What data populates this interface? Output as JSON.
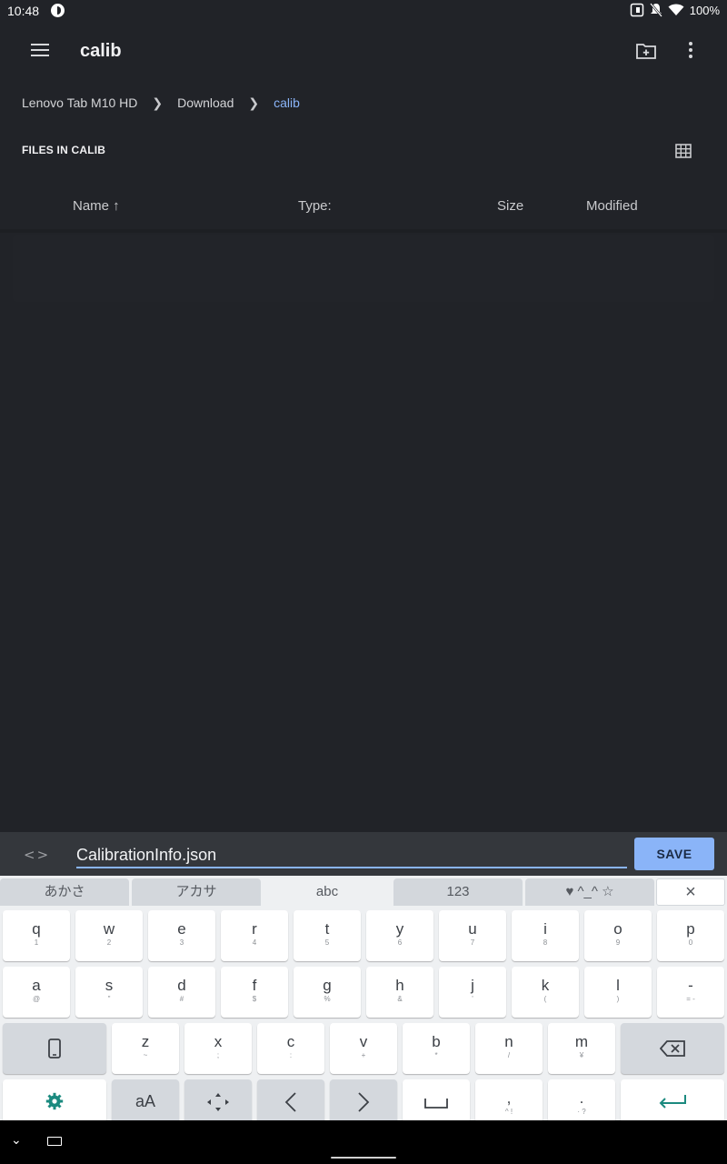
{
  "status_bar": {
    "time": "10:48",
    "battery": "100%"
  },
  "toolbar": {
    "title": "calib"
  },
  "breadcrumb": [
    {
      "label": "Lenovo Tab M10 HD"
    },
    {
      "label": "Download"
    },
    {
      "label": "calib"
    }
  ],
  "section": {
    "title": "FILES IN CALIB"
  },
  "columns": {
    "name": "Name ↑",
    "type": "Type:",
    "size": "Size",
    "modified": "Modified"
  },
  "save_bar": {
    "filename": "CalibrationInfo.json",
    "save_label": "SAVE"
  },
  "keyboard": {
    "tabs": [
      "あかさ",
      "アカサ",
      "abc",
      "123",
      "♥ ^_^ ☆"
    ],
    "active_tab": "abc",
    "close": "×",
    "row1": [
      {
        "k": "q",
        "s": "1"
      },
      {
        "k": "w",
        "s": "2"
      },
      {
        "k": "e",
        "s": "3"
      },
      {
        "k": "r",
        "s": "4"
      },
      {
        "k": "t",
        "s": "5"
      },
      {
        "k": "y",
        "s": "6"
      },
      {
        "k": "u",
        "s": "7"
      },
      {
        "k": "i",
        "s": "8"
      },
      {
        "k": "o",
        "s": "9"
      },
      {
        "k": "p",
        "s": "0"
      }
    ],
    "row2": [
      {
        "k": "a",
        "s": "@"
      },
      {
        "k": "s",
        "s": "\""
      },
      {
        "k": "d",
        "s": "#"
      },
      {
        "k": "f",
        "s": "$"
      },
      {
        "k": "g",
        "s": "%"
      },
      {
        "k": "h",
        "s": "&"
      },
      {
        "k": "j",
        "s": "'"
      },
      {
        "k": "k",
        "s": "("
      },
      {
        "k": "l",
        "s": ")"
      },
      {
        "k": "-",
        "s": "= -"
      }
    ],
    "row3": [
      {
        "k": "z",
        "s": "~"
      },
      {
        "k": "x",
        "s": ";"
      },
      {
        "k": "c",
        "s": ":"
      },
      {
        "k": "v",
        "s": "+"
      },
      {
        "k": "b",
        "s": "*"
      },
      {
        "k": "n",
        "s": "/"
      },
      {
        "k": "m",
        "s": "¥"
      }
    ],
    "row4": {
      "case_label": "aA",
      "comma": ",",
      "comma_sub": "^ !",
      "period": ".",
      "period_sub": "· ?"
    }
  },
  "colors": {
    "accent": "#8ab4f8",
    "background": "#212328",
    "keyboard": "#eef0f2"
  }
}
